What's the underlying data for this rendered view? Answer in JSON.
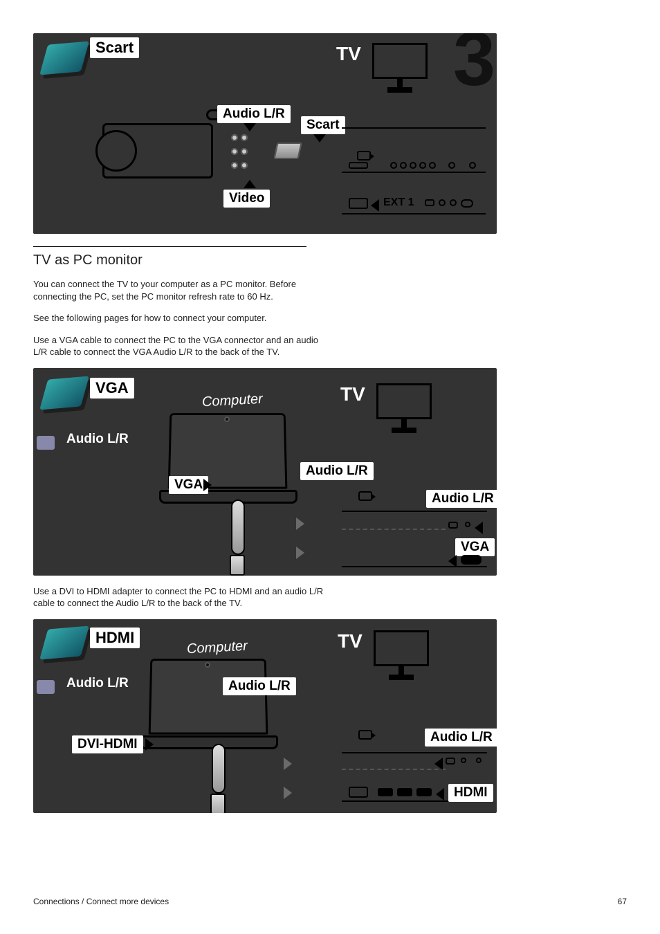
{
  "page_number": "67",
  "footer": "Connections / Connect more devices",
  "section": {
    "title": "TV as PC monitor",
    "p1": "You can connect the TV to your computer as a PC monitor. Before connecting the PC, set the PC monitor refresh rate to 60 Hz.",
    "p2": "See the following pages for how to connect your computer.",
    "p3": "Use a VGA cable to connect the PC to the VGA connector and an audio L/R cable to connect the VGA Audio L/R to the back of the TV.",
    "p4": "Use a DVI to HDMI adapter to connect the PC to HDMI and an audio L/R cable to connect the Audio L/R to the back of the TV."
  },
  "diagram1": {
    "big_number": "3",
    "cable_scart": "Scart",
    "tv": "TV",
    "audio_lr": "Audio L/R",
    "scart": "Scart",
    "video": "Video",
    "ext1": "EXT 1"
  },
  "diagram2": {
    "vga_cable": "VGA",
    "audio_cable": "Audio L/R",
    "computer": "Computer",
    "tv": "TV",
    "vga": "VGA",
    "audio_lr_mid": "Audio L/R",
    "audio_lr_tv": "Audio L/R",
    "vga_tv": "VGA"
  },
  "diagram3": {
    "hdmi_cable": "HDMI",
    "audio_cable": "Audio L/R",
    "computer": "Computer",
    "tv": "TV",
    "audio_lr_mid": "Audio L/R",
    "dvi_hdmi": "DVI-HDMI",
    "audio_lr_tv": "Audio L/R",
    "hdmi_tv": "HDMI"
  }
}
